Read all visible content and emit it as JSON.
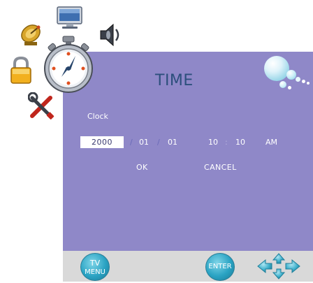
{
  "menu": {
    "title": "TIME",
    "side_icons": [
      "satellite-icon",
      "monitor-icon",
      "speaker-icon",
      "lock-icon",
      "clock-icon",
      "tools-icon"
    ]
  },
  "clock": {
    "label": "Clock",
    "year": "2000",
    "month": "01",
    "day": "01",
    "hour": "10",
    "minute": "10",
    "ampm": "AM",
    "date_separator": "/",
    "time_separator": ":"
  },
  "actions": {
    "ok": "OK",
    "cancel": "CANCEL"
  },
  "footer": {
    "tv_menu_top": "TV",
    "tv_menu_bottom": "MENU",
    "enter": "ENTER",
    "nav_icon": "direction-pad-icon"
  },
  "colors": {
    "panel": "#8f88c8",
    "title": "#2c4f7c",
    "footer": "#d9d9d9",
    "button": "#2aa3c3"
  }
}
